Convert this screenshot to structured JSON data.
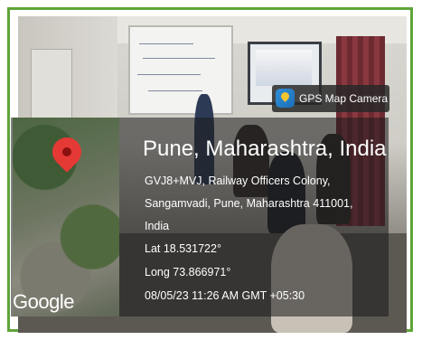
{
  "overlay": {
    "app_name": "GPS Map Camera",
    "location_title": "Pune, Maharashtra, India",
    "address_line1": "GVJ8+MVJ, Railway Officers Colony,",
    "address_line2": "Sangamvadi, Pune, Maharashtra 411001,",
    "address_line3": "India",
    "latitude": "Lat 18.531722°",
    "longitude": "Long 73.866971°",
    "timestamp": "08/05/23 11:26 AM GMT +05:30",
    "map_brand": "Google"
  },
  "colors": {
    "frame_border": "#5fa53a",
    "pin": "#e53935"
  },
  "icons": [
    "gps-map-camera-app-icon",
    "map-pin-icon"
  ]
}
